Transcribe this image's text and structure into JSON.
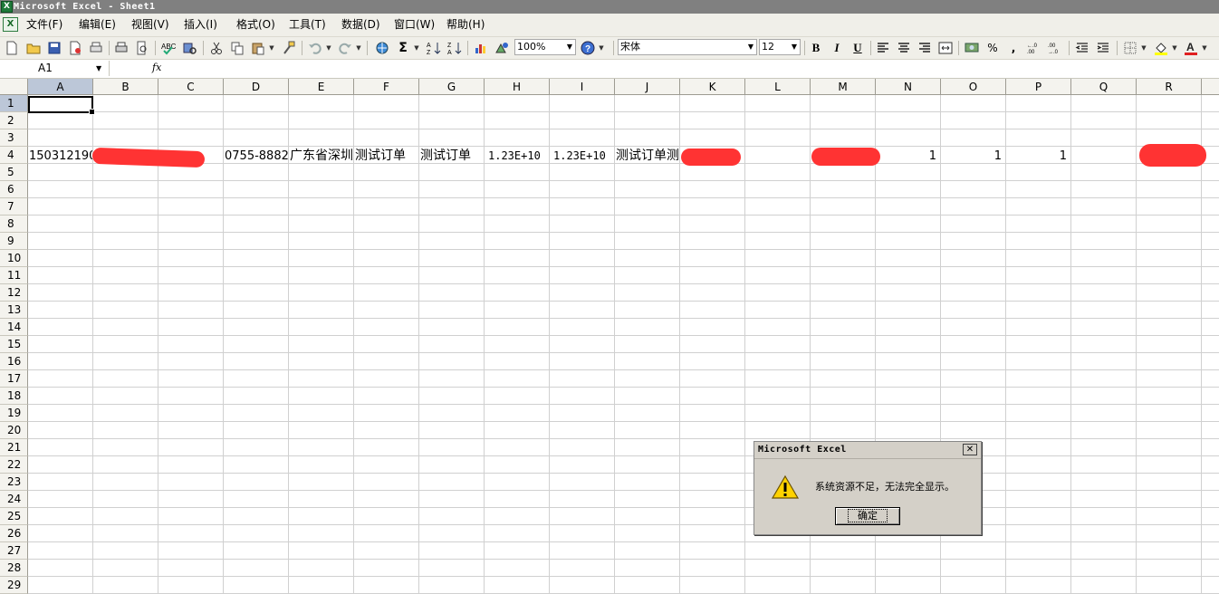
{
  "window": {
    "title": "Microsoft Excel - Sheet1"
  },
  "menus": [
    "文件(F)",
    "编辑(E)",
    "视图(V)",
    "插入(I)",
    "格式(O)",
    "工具(T)",
    "数据(D)",
    "窗口(W)",
    "帮助(H)"
  ],
  "toolbar": {
    "zoom": "100%",
    "font": "宋体",
    "font_size": "12",
    "bold": "B",
    "italic": "I",
    "underline": "U",
    "sum": "Σ",
    "percent": "%",
    "comma": ","
  },
  "formula_bar": {
    "name_box": "A1",
    "fx": "fx"
  },
  "sheet": {
    "columns": [
      "A",
      "B",
      "C",
      "D",
      "E",
      "F",
      "G",
      "H",
      "I",
      "J",
      "K",
      "L",
      "M",
      "N",
      "O",
      "P",
      "Q",
      "R"
    ],
    "rows": [
      "1",
      "2",
      "3",
      "4",
      "5",
      "6",
      "7",
      "8",
      "9",
      "10",
      "11",
      "12",
      "13",
      "14",
      "15",
      "16",
      "17",
      "18",
      "19",
      "20",
      "21",
      "22",
      "23",
      "24",
      "25",
      "26",
      "27",
      "28",
      "29"
    ],
    "row4": {
      "A": "150312190",
      "D": "0755-8882",
      "E": "广东省深圳",
      "F": "测试订单",
      "G": "测试订单",
      "H": "1.23E+10",
      "I": "1.23E+10",
      "J": "测试订单测",
      "N": "1",
      "O": "1",
      "P": "1"
    }
  },
  "dialog": {
    "title": "Microsoft Excel",
    "message": "系统资源不足，无法完全显示。",
    "ok": "确定",
    "close": "✕"
  },
  "colors": {
    "titlebar": "#808080",
    "redaction": "#ff3333",
    "selection_header": "#bcc7d8"
  }
}
